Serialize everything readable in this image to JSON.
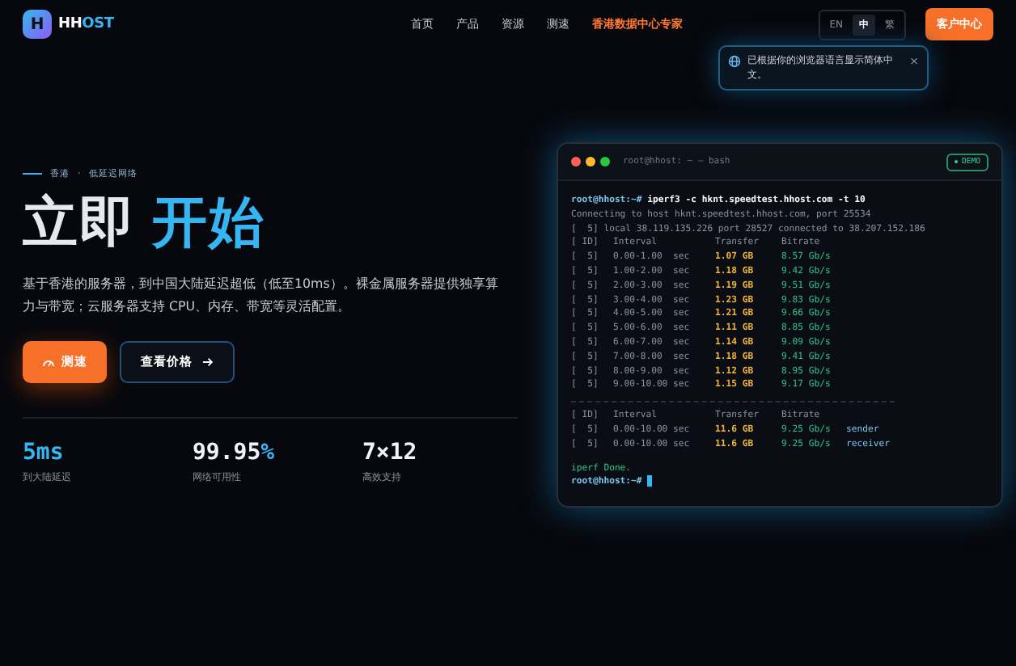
{
  "nav": {
    "logo_mark": "H",
    "brand_a": "HH",
    "brand_b": "OST",
    "links": [
      {
        "label": "首页",
        "highlight": false
      },
      {
        "label": "产品",
        "highlight": false
      },
      {
        "label": "资源",
        "highlight": false
      },
      {
        "label": "测速",
        "highlight": false
      },
      {
        "label": "香港数据中心专家",
        "highlight": true
      }
    ],
    "languages": [
      {
        "label": "EN",
        "selected": false
      },
      {
        "label": "中",
        "selected": true
      },
      {
        "label": "繁",
        "selected": false
      }
    ],
    "cta": "客户中心"
  },
  "notice": {
    "text": "已根据你的浏览器语言显示简体中文。",
    "close": "×"
  },
  "hero": {
    "eyebrow_a": "香港",
    "eyebrow_sep": "·",
    "eyebrow_b": "低延迟网络",
    "title_a": "立即",
    "title_b": "开始",
    "description": "基于香港的服务器，到中国大陆延迟超低（低至10ms）。裸金属服务器提供独享算力与带宽；云服务器支持 CPU、内存、带宽等灵活配置。",
    "primary_button": "测速",
    "secondary_button": "查看价格",
    "stats": [
      {
        "parts": [
          {
            "text": "5ms",
            "accent": true
          }
        ],
        "label": "到大陆延迟"
      },
      {
        "parts": [
          {
            "text": "99.95",
            "accent": false
          },
          {
            "text": "%",
            "accent": true
          }
        ],
        "label": "网络可用性"
      },
      {
        "parts": [
          {
            "text": "7×12",
            "accent": false
          }
        ],
        "label": "高效支持"
      }
    ]
  },
  "terminal": {
    "title": "root@hhost: ~ — bash",
    "badge": "DEMO",
    "lines": [
      {
        "kind": "prompt",
        "prompt": "root@hhost:~#",
        "command": "iperf3 -c hknt.speedtest.hhost.com -t 10",
        "cursor": false
      },
      {
        "kind": "muted",
        "text": "Connecting to host hknt.speedtest.hhost.com, port 25534"
      },
      {
        "kind": "muted",
        "text": "[  5] local 38.119.135.226 port 28527 connected to 38.207.152.186"
      },
      {
        "kind": "header",
        "id": "[ ID]",
        "interval": "Interval",
        "transfer": "Transfer",
        "bitrate": "Bitrate"
      },
      {
        "kind": "row",
        "id": "[  5]",
        "interval": "0.00-1.00  sec",
        "transfer": "1.07 GB",
        "bitrate": "8.57 Gb/s"
      },
      {
        "kind": "row",
        "id": "[  5]",
        "interval": "1.00-2.00  sec",
        "transfer": "1.18 GB",
        "bitrate": "9.42 Gb/s"
      },
      {
        "kind": "row",
        "id": "[  5]",
        "interval": "2.00-3.00  sec",
        "transfer": "1.19 GB",
        "bitrate": "9.51 Gb/s"
      },
      {
        "kind": "row",
        "id": "[  5]",
        "interval": "3.00-4.00  sec",
        "transfer": "1.23 GB",
        "bitrate": "9.83 Gb/s"
      },
      {
        "kind": "row",
        "id": "[  5]",
        "interval": "4.00-5.00  sec",
        "transfer": "1.21 GB",
        "bitrate": "9.66 Gb/s"
      },
      {
        "kind": "row",
        "id": "[  5]",
        "interval": "5.00-6.00  sec",
        "transfer": "1.11 GB",
        "bitrate": "8.85 Gb/s"
      },
      {
        "kind": "row",
        "id": "[  5]",
        "interval": "6.00-7.00  sec",
        "transfer": "1.14 GB",
        "bitrate": "9.09 Gb/s"
      },
      {
        "kind": "row",
        "id": "[  5]",
        "interval": "7.00-8.00  sec",
        "transfer": "1.18 GB",
        "bitrate": "9.41 Gb/s"
      },
      {
        "kind": "row",
        "id": "[  5]",
        "interval": "8.00-9.00  sec",
        "transfer": "1.12 GB",
        "bitrate": "8.95 Gb/s"
      },
      {
        "kind": "row",
        "id": "[  5]",
        "interval": "9.00-10.00 sec",
        "transfer": "1.15 GB",
        "bitrate": "9.17 Gb/s"
      },
      {
        "kind": "rule"
      },
      {
        "kind": "header",
        "id": "[ ID]",
        "interval": "Interval",
        "transfer": "Transfer",
        "bitrate": "Bitrate"
      },
      {
        "kind": "row",
        "id": "[  5]",
        "interval": "0.00-10.00 sec",
        "transfer": "11.6 GB",
        "bitrate": "9.25 Gb/s",
        "role": "sender"
      },
      {
        "kind": "row",
        "id": "[  5]",
        "interval": "0.00-10.00 sec",
        "transfer": "11.6 GB",
        "bitrate": "9.25 Gb/s",
        "role": "receiver"
      },
      {
        "kind": "gap"
      },
      {
        "kind": "success",
        "text": "iperf Done."
      },
      {
        "kind": "prompt",
        "prompt": "root@hhost:~#",
        "cursor": true
      }
    ]
  }
}
